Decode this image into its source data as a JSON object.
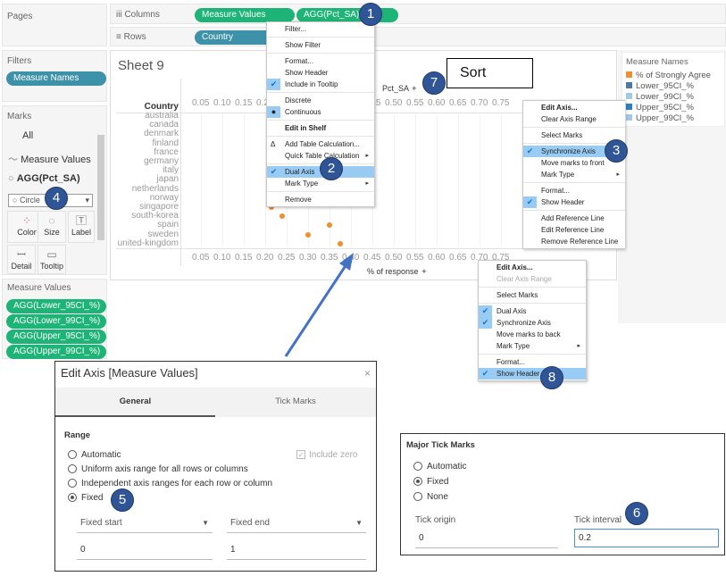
{
  "shelves": {
    "pages_label": "Pages",
    "columns_icon": "columns-icon",
    "columns_label": "Columns",
    "rows_label": "Rows",
    "columns_pills": [
      "Measure Values",
      "AGG(Pct_SA)"
    ],
    "rows_pills": [
      "Country"
    ]
  },
  "filters": {
    "label": "Filters",
    "pills": [
      "Measure Names"
    ]
  },
  "marks": {
    "label": "Marks",
    "items": [
      "All",
      "Measure Values",
      "AGG(Pct_SA)"
    ],
    "mark_type": "Circle",
    "cards": [
      {
        "label": "Color",
        "icon": "color-icon"
      },
      {
        "label": "Size",
        "icon": "size-icon"
      },
      {
        "label": "Label",
        "icon": "label-icon"
      },
      {
        "label": "Detail",
        "icon": "detail-icon"
      },
      {
        "label": "Tooltip",
        "icon": "tooltip-icon"
      }
    ]
  },
  "measure_values": {
    "label": "Measure Values",
    "pills": [
      "AGG(Lower_95CI_%)",
      "AGG(Lower_99CI_%)",
      "AGG(Upper_95CI_%)",
      "AGG(Upper_99CI_%)"
    ]
  },
  "sheet": {
    "title": "Sheet 9",
    "row_header": "Country",
    "top_axis_title": "Pct_SA",
    "bottom_axis_title": "% of response"
  },
  "chart_data": {
    "type": "scatter",
    "xlim": [
      0.05,
      0.75
    ],
    "ticks": [
      "0.05",
      "0.10",
      "0.15",
      "0.20",
      "0.25",
      "0.30",
      "0.35",
      "0.40",
      "0.45",
      "0.50",
      "0.55",
      "0.60",
      "0.65",
      "0.70",
      "0.75"
    ],
    "categories": [
      "australia",
      "canada",
      "denmark",
      "finland",
      "france",
      "germany",
      "italy",
      "japan",
      "netherlands",
      "norway",
      "singapore",
      "south-korea",
      "spain",
      "sweden",
      "united-kingdom"
    ],
    "visible_points": [
      {
        "country": "singapore",
        "value": 0.215
      },
      {
        "country": "south-korea",
        "value": 0.24
      },
      {
        "country": "spain",
        "value": 0.35
      },
      {
        "country": "sweden",
        "value": 0.3
      },
      {
        "country": "united-kingdom",
        "value": 0.375
      }
    ],
    "point_color": "#f28e2b"
  },
  "legend": {
    "title": "Measure Names",
    "items": [
      {
        "label": "% of Strongly Agree",
        "color": "#f28e2b"
      },
      {
        "label": "Lower_95CI_%",
        "color": "#4e79a7"
      },
      {
        "label": "Lower_99CI_%",
        "color": "#a0cbe8"
      },
      {
        "label": "Upper_95CI_%",
        "color": "#2f7fc1"
      },
      {
        "label": "Upper_99CI_%",
        "color": "#a0cbe8"
      }
    ]
  },
  "menu1": [
    "Filter...",
    "Show Filter",
    "Format...",
    "Show Header",
    "Include in Tooltip",
    "Discrete",
    "Continuous",
    "Edit in Shelf",
    "Add Table Calculation...",
    "Quick Table Calculation",
    "Dual Axis",
    "Mark Type",
    "Remove"
  ],
  "menu2": [
    "Edit Axis...",
    "Clear Axis Range",
    "Select Marks",
    "Synchronize Axis",
    "Move marks to front",
    "Mark Type",
    "Format...",
    "Show Header",
    "Add Reference Line",
    "Edit Reference Line",
    "Remove Reference Line"
  ],
  "menu3": [
    "Edit Axis...",
    "Clear Axis Range",
    "Select Marks",
    "Dual Axis",
    "Synchronize Axis",
    "Move marks to back",
    "Mark Type",
    "Format...",
    "Show Header"
  ],
  "sort_label": "Sort",
  "badges": [
    "1",
    "2",
    "3",
    "4",
    "5",
    "6",
    "7",
    "8"
  ],
  "edit_axis": {
    "title": "Edit Axis [Measure Values]",
    "close": "×",
    "tabs": [
      "General",
      "Tick Marks"
    ],
    "range_label": "Range",
    "options": [
      "Automatic",
      "Uniform axis range for all rows or columns",
      "Independent axis ranges for each row or column",
      "Fixed"
    ],
    "selected": "Fixed",
    "include_zero": "Include zero",
    "fixed_start_label": "Fixed start",
    "fixed_end_label": "Fixed end",
    "fixed_start": "0",
    "fixed_end": "1"
  },
  "tick_marks": {
    "title": "Major Tick Marks",
    "options": [
      "Automatic",
      "Fixed",
      "None"
    ],
    "selected": "Fixed",
    "origin_label": "Tick origin",
    "interval_label": "Tick interval",
    "origin": "0",
    "interval": "0.2"
  },
  "colors": {
    "accent_pill": "#1eb478",
    "dimension_pill": "#3d91a8",
    "badge": "#2f5597",
    "highlight": "#99ccf5"
  }
}
